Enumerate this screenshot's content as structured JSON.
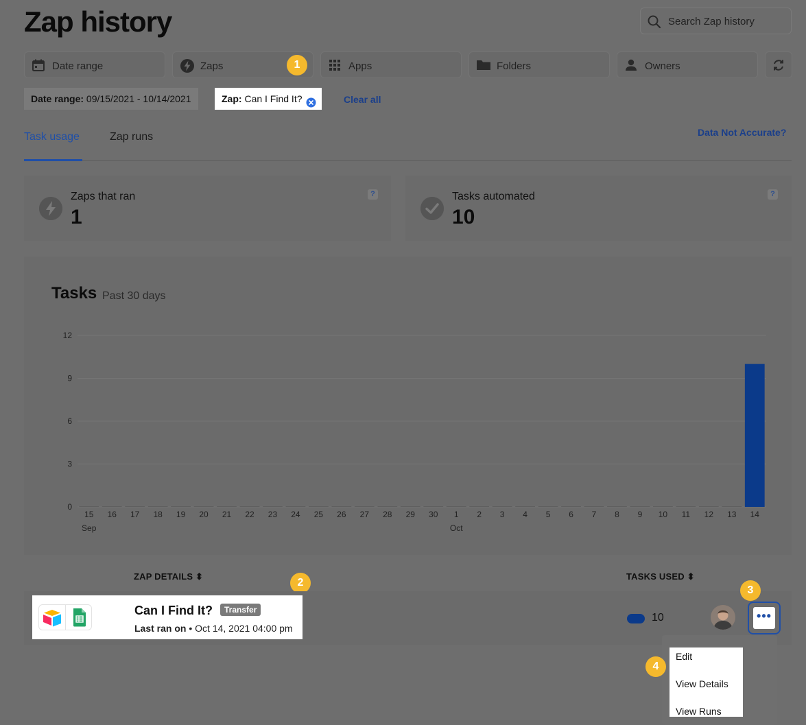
{
  "header": {
    "title": "Zap history",
    "search_placeholder": "Search Zap history"
  },
  "filters": [
    {
      "label": "Date range",
      "icon": "calendar-icon"
    },
    {
      "label": "Zaps",
      "icon": "bolt-icon"
    },
    {
      "label": "Apps",
      "icon": "apps-grid-icon"
    },
    {
      "label": "Folders",
      "icon": "folder-icon"
    },
    {
      "label": "Owners",
      "icon": "person-icon"
    }
  ],
  "active_filters": {
    "date_range_key": "Date range:",
    "date_range_value": "09/15/2021 - 10/14/2021",
    "zap_key": "Zap:",
    "zap_value": "Can I Find It?",
    "clear_all": "Clear all"
  },
  "tabs": [
    {
      "label": "Task usage",
      "active": true
    },
    {
      "label": "Zap runs",
      "active": false
    }
  ],
  "data_not_accurate": "Data Not Accurate?",
  "stats": [
    {
      "label": "Zaps that ran",
      "value": "1",
      "help": "?"
    },
    {
      "label": "Tasks automated",
      "value": "10",
      "help": "?"
    }
  ],
  "chart": {
    "title": "Tasks",
    "subtitle": "Past 30 days"
  },
  "chart_data": {
    "type": "bar",
    "title": "Tasks",
    "subtitle": "Past 30 days",
    "categories": [
      "15",
      "16",
      "17",
      "18",
      "19",
      "20",
      "21",
      "22",
      "23",
      "24",
      "25",
      "26",
      "27",
      "28",
      "29",
      "30",
      "1",
      "2",
      "3",
      "4",
      "5",
      "6",
      "7",
      "8",
      "9",
      "10",
      "11",
      "12",
      "13",
      "14"
    ],
    "month_labels": [
      {
        "at": "15",
        "label": "Sep"
      },
      {
        "at": "1",
        "label": "Oct"
      }
    ],
    "values": [
      0,
      0,
      0,
      0,
      0,
      0,
      0,
      0,
      0,
      0,
      0,
      0,
      0,
      0,
      0,
      0,
      0,
      0,
      0,
      0,
      0,
      0,
      0,
      0,
      0,
      0,
      0,
      0,
      0,
      10
    ],
    "yticks": [
      0,
      3,
      6,
      9,
      12
    ],
    "ylim": [
      0,
      12
    ],
    "bar_color": "#0b3a8a",
    "grid": true
  },
  "table": {
    "col_details": "ZAP DETAILS",
    "col_tasks": "TASKS USED",
    "sort_glyph": "⬍",
    "row": {
      "name": "Can I Find It?",
      "tag": "Transfer",
      "last_ran_label": "Last ran on",
      "last_ran_value": "• Oct 14, 2021 04:00 pm",
      "tasks_used": "10"
    }
  },
  "actions_menu": {
    "items": [
      "Edit",
      "View Details",
      "View Runs"
    ],
    "more_glyph": "•••"
  },
  "callouts": [
    "1",
    "2",
    "3",
    "4"
  ]
}
